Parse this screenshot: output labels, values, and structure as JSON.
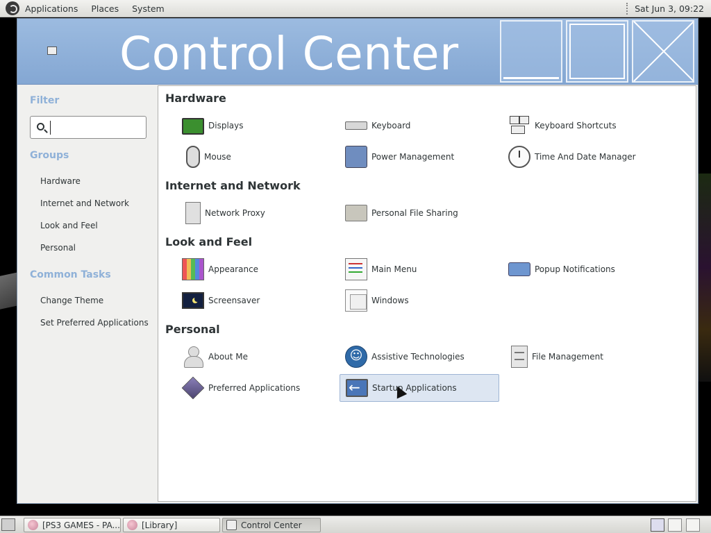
{
  "top_panel": {
    "menus": [
      "Applications",
      "Places",
      "System"
    ],
    "clock": "Sat Jun  3, 09:22"
  },
  "window": {
    "title": "Control Center",
    "icon_text": "•▪▪"
  },
  "sidebar": {
    "filter_heading": "Filter",
    "search_placeholder": "",
    "groups_heading": "Groups",
    "groups": [
      "Hardware",
      "Internet and Network",
      "Look and Feel",
      "Personal"
    ],
    "tasks_heading": "Common Tasks",
    "tasks": [
      "Change Theme",
      "Set Preferred Applications"
    ]
  },
  "content": {
    "sections": [
      {
        "title": "Hardware",
        "items": [
          {
            "label": "Displays",
            "icon": "display-icon"
          },
          {
            "label": "Keyboard",
            "icon": "keyboard-icon"
          },
          {
            "label": "Keyboard Shortcuts",
            "icon": "keyboard-shortcuts-icon"
          },
          {
            "label": "Mouse",
            "icon": "mouse-icon"
          },
          {
            "label": "Power Management",
            "icon": "power-icon"
          },
          {
            "label": "Time And Date Manager",
            "icon": "clock-icon"
          }
        ]
      },
      {
        "title": "Internet and Network",
        "items": [
          {
            "label": "Network Proxy",
            "icon": "network-proxy-icon"
          },
          {
            "label": "Personal File Sharing",
            "icon": "file-sharing-icon"
          }
        ]
      },
      {
        "title": "Look and Feel",
        "items": [
          {
            "label": "Appearance",
            "icon": "appearance-icon"
          },
          {
            "label": "Main Menu",
            "icon": "main-menu-icon"
          },
          {
            "label": "Popup Notifications",
            "icon": "popup-notifications-icon"
          },
          {
            "label": "Screensaver",
            "icon": "screensaver-icon"
          },
          {
            "label": "Windows",
            "icon": "windows-icon"
          }
        ]
      },
      {
        "title": "Personal",
        "items": [
          {
            "label": "About Me",
            "icon": "about-me-icon"
          },
          {
            "label": "Assistive Technologies",
            "icon": "accessibility-icon"
          },
          {
            "label": "File Management",
            "icon": "file-management-icon"
          },
          {
            "label": "Preferred Applications",
            "icon": "preferred-apps-icon"
          },
          {
            "label": "Startup Applications",
            "icon": "startup-apps-icon",
            "selected": true
          }
        ]
      }
    ]
  },
  "taskbar": {
    "tasks": [
      {
        "label": "[PS3 GAMES - PA...",
        "icon": "game-icon"
      },
      {
        "label": "[Library]",
        "icon": "game-icon"
      },
      {
        "label": "Control Center",
        "icon": "control-center-icon",
        "active": true
      }
    ]
  }
}
